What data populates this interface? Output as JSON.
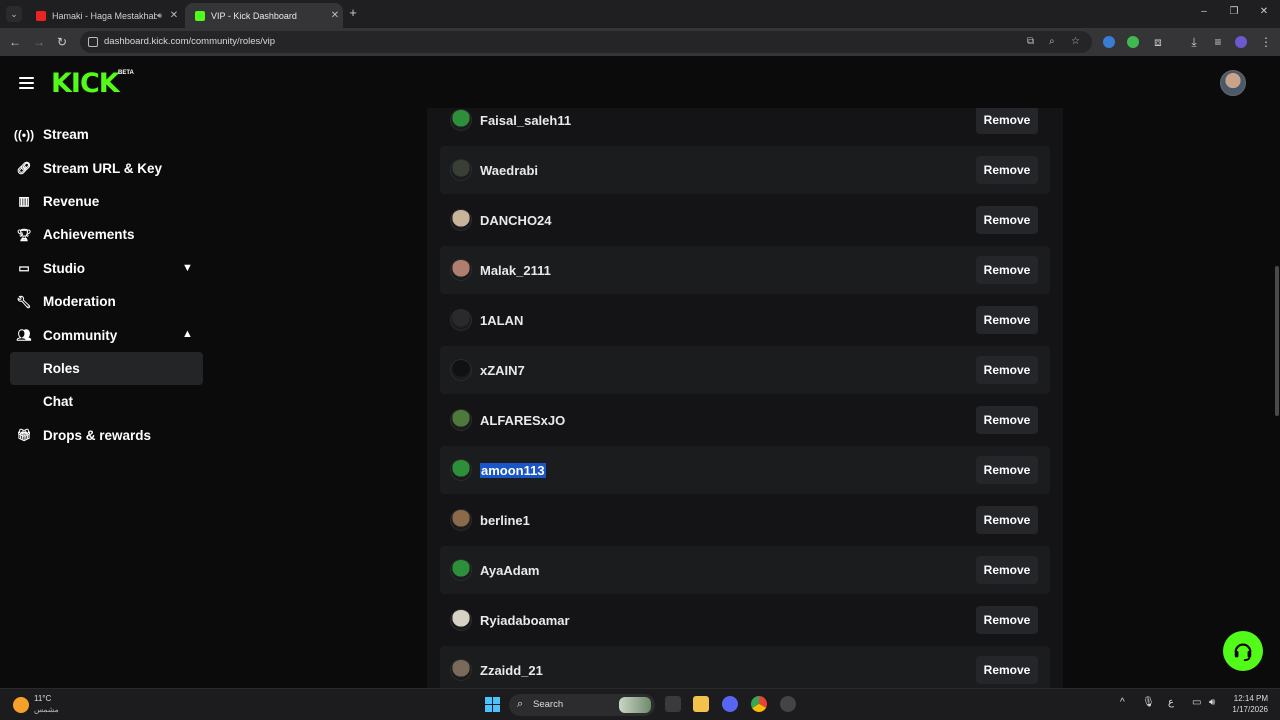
{
  "browser": {
    "tabs": [
      {
        "title": "Hamaki - Haga Mestakhaba",
        "active": false
      },
      {
        "title": "VIP - Kick Dashboard",
        "active": true
      }
    ],
    "url": "dashboard.kick.com/community/roles/vip"
  },
  "header": {
    "logo": "KICK",
    "logo_badge": "BETA"
  },
  "sidebar": {
    "items": [
      {
        "label": "Stream",
        "icon": "broadcast-icon"
      },
      {
        "label": "Stream URL & Key",
        "icon": "link-icon"
      },
      {
        "label": "Revenue",
        "icon": "chart-icon"
      },
      {
        "label": "Achievements",
        "icon": "trophy-icon"
      },
      {
        "label": "Studio",
        "icon": "camera-icon"
      },
      {
        "label": "Moderation",
        "icon": "wrench-icon"
      },
      {
        "label": "Community",
        "icon": "people-icon"
      },
      {
        "label": "Drops & rewards",
        "icon": "gift-icon"
      }
    ],
    "community_sub": [
      {
        "label": "Roles",
        "active": true
      },
      {
        "label": "Chat",
        "active": false
      }
    ]
  },
  "vip_list": {
    "remove_label": "Remove",
    "users": [
      {
        "name": "Faisal_saleh11",
        "avatar": "#2e8f3a"
      },
      {
        "name": "Waedrabi",
        "avatar": "#3a3f36"
      },
      {
        "name": "DANCHO24",
        "avatar": "#c8b49a"
      },
      {
        "name": "Malak_2111",
        "avatar": "#b07e6e"
      },
      {
        "name": "1ALAN",
        "avatar": "#2a2a2a"
      },
      {
        "name": "xZAIN7",
        "avatar": "#111111"
      },
      {
        "name": "ALFARESxJO",
        "avatar": "#4d7a3a"
      },
      {
        "name": "amoon113",
        "avatar": "#2e8f3a",
        "selected": true
      },
      {
        "name": "berline1",
        "avatar": "#8a6a4a"
      },
      {
        "name": "AyaAdam",
        "avatar": "#2e8f3a"
      },
      {
        "name": "Ryiadaboamar",
        "avatar": "#d8d2c4"
      },
      {
        "name": "Zzaidd_21",
        "avatar": "#7a6a5a"
      }
    ]
  },
  "taskbar": {
    "temperature": "11°C",
    "weather": "مشمس",
    "search_label": "Search",
    "time": "12:14 PM",
    "date": "1/17/2026",
    "lang": "ع"
  },
  "colors": {
    "brand": "#53fc18",
    "selection": "#1a56c7"
  }
}
